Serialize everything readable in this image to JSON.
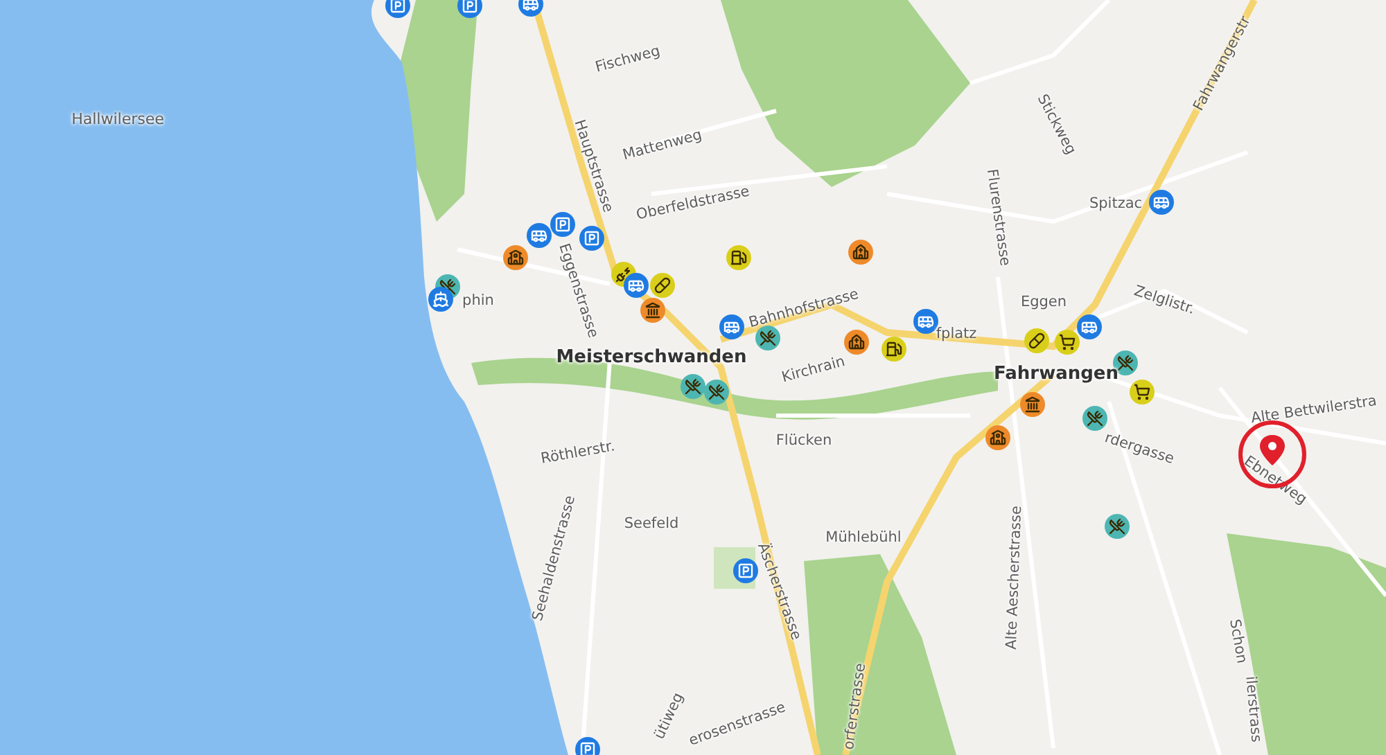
{
  "map": {
    "labels": [
      {
        "text": "Hallwilersee",
        "kind": "lake"
      },
      {
        "text": "Fischweg",
        "kind": "street"
      },
      {
        "text": "Mattenweg",
        "kind": "street"
      },
      {
        "text": "Oberfeldstrasse",
        "kind": "street"
      },
      {
        "text": "Hauptstrasse",
        "kind": "street"
      },
      {
        "text": "Eggenstrasse",
        "kind": "street"
      },
      {
        "text": "phin",
        "kind": "place"
      },
      {
        "text": "Meisterschwanden",
        "kind": "town"
      },
      {
        "text": "Bahnhofstrasse",
        "kind": "street"
      },
      {
        "text": "Kirchrain",
        "kind": "street"
      },
      {
        "text": "Fahrwangerstr",
        "kind": "street"
      },
      {
        "text": "Stickweg",
        "kind": "street"
      },
      {
        "text": "Flurenstrasse",
        "kind": "street"
      },
      {
        "text": "Spitzac",
        "kind": "place"
      },
      {
        "text": "Eggen",
        "kind": "place"
      },
      {
        "text": "Zelglistr.",
        "kind": "street"
      },
      {
        "text": "fplatz",
        "kind": "street"
      },
      {
        "text": "Fahrwangen",
        "kind": "town"
      },
      {
        "text": "Röthlerstr.",
        "kind": "street"
      },
      {
        "text": "Seefeld",
        "kind": "place"
      },
      {
        "text": "Seehaldenstrasse",
        "kind": "street"
      },
      {
        "text": "Flücken",
        "kind": "place"
      },
      {
        "text": "Mühlebühl",
        "kind": "place"
      },
      {
        "text": "Äscherstrasse",
        "kind": "street"
      },
      {
        "text": "ütiweg",
        "kind": "street"
      },
      {
        "text": "erosenstrasse",
        "kind": "street"
      },
      {
        "text": "orferstrasse",
        "kind": "street"
      },
      {
        "text": "rdergasse",
        "kind": "street"
      },
      {
        "text": "Alte Aescherstrasse",
        "kind": "street"
      },
      {
        "text": "Alte Bettwilerstra",
        "kind": "street"
      },
      {
        "text": "Ebnetweg",
        "kind": "street"
      },
      {
        "text": "Schon",
        "kind": "street"
      },
      {
        "text": "ilerstrass",
        "kind": "street"
      }
    ],
    "markers": [
      {
        "kind": "parking",
        "color": "#1f7be2"
      },
      {
        "kind": "parking",
        "color": "#1f7be2"
      },
      {
        "kind": "bus",
        "color": "#1f7be2"
      },
      {
        "kind": "bus",
        "color": "#1f7be2"
      },
      {
        "kind": "parking",
        "color": "#1f7be2"
      },
      {
        "kind": "parking",
        "color": "#1f7be2"
      },
      {
        "kind": "school",
        "color": "#ee8a2a"
      },
      {
        "kind": "restaurant",
        "color": "#4db6b2"
      },
      {
        "kind": "ship",
        "color": "#1f7be2"
      },
      {
        "kind": "charging",
        "color": "#d9cf1a"
      },
      {
        "kind": "bus",
        "color": "#1f7be2"
      },
      {
        "kind": "pharmacy",
        "color": "#d9cf1a"
      },
      {
        "kind": "museum",
        "color": "#ee8a2a"
      },
      {
        "kind": "fuel",
        "color": "#d9cf1a"
      },
      {
        "kind": "church",
        "color": "#ee8a2a"
      },
      {
        "kind": "bus",
        "color": "#1f7be2"
      },
      {
        "kind": "restaurant",
        "color": "#4db6b2"
      },
      {
        "kind": "restaurant",
        "color": "#4db6b2"
      },
      {
        "kind": "restaurant",
        "color": "#4db6b2"
      },
      {
        "kind": "church",
        "color": "#ee8a2a"
      },
      {
        "kind": "fuel",
        "color": "#d9cf1a"
      },
      {
        "kind": "bus",
        "color": "#1f7be2"
      },
      {
        "kind": "bus",
        "color": "#1f7be2"
      },
      {
        "kind": "pharmacy",
        "color": "#d9cf1a"
      },
      {
        "kind": "cart",
        "color": "#d9cf1a"
      },
      {
        "kind": "bus",
        "color": "#1f7be2"
      },
      {
        "kind": "restaurant",
        "color": "#4db6b2"
      },
      {
        "kind": "museum",
        "color": "#ee8a2a"
      },
      {
        "kind": "cart",
        "color": "#d9cf1a"
      },
      {
        "kind": "school",
        "color": "#ee8a2a"
      },
      {
        "kind": "restaurant",
        "color": "#4db6b2"
      },
      {
        "kind": "restaurant",
        "color": "#4db6b2"
      },
      {
        "kind": "parking",
        "color": "#1f7be2"
      },
      {
        "kind": "parking",
        "color": "#1f7be2"
      }
    ]
  }
}
